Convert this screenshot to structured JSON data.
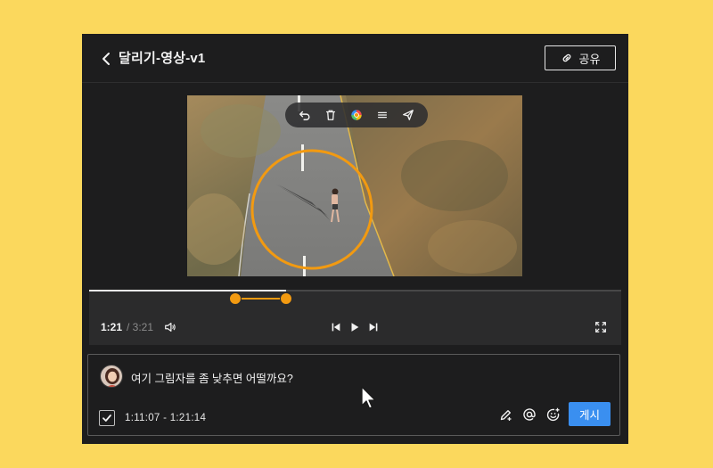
{
  "header": {
    "title": "달리기-영상-v1",
    "share_label": "공유",
    "back_icon": "chevron-left-icon",
    "share_icon": "link-icon"
  },
  "video": {
    "toolbar_icons": [
      "undo-icon",
      "trash-icon",
      "color-picker-icon",
      "menu-icon",
      "send-icon"
    ],
    "annotation_color": "#f29a11"
  },
  "player": {
    "current_time": "1:21",
    "total_time": "/ 3:21",
    "played_fraction": 0.37,
    "range_start_fraction": 0.275,
    "range_end_fraction": 0.37,
    "accent_color": "#f29a11"
  },
  "comment": {
    "text": "여기 그림자를 좀 낮추면 어떨까요?",
    "time_range": "1:11:07 - 1:21:14",
    "post_label": "게시",
    "post_color": "#3a8ff0"
  }
}
